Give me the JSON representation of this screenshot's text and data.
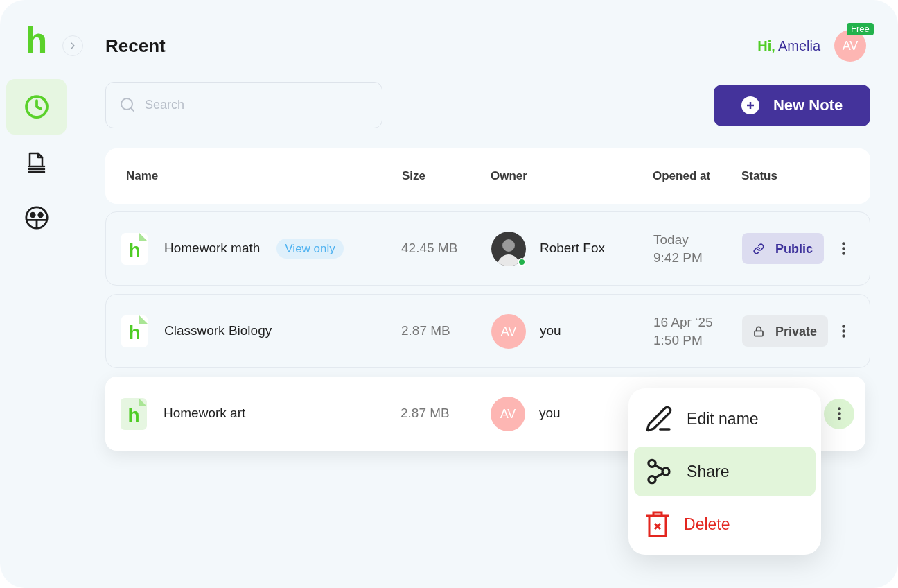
{
  "logo": {
    "text": "h"
  },
  "sidebar": {
    "items": [
      {
        "kind": "recent",
        "selected": true
      },
      {
        "kind": "notes",
        "selected": false
      },
      {
        "kind": "community",
        "selected": false
      }
    ]
  },
  "header": {
    "title": "Recent",
    "greeting_prefix": "Hi,",
    "greeting_name": "Amelia",
    "avatar_initials": "AV",
    "plan_badge": "Free"
  },
  "search": {
    "placeholder": "Search"
  },
  "new_note_button": {
    "label": "New Note"
  },
  "table": {
    "columns": [
      "Name",
      "Size",
      "Owner",
      "Opened at",
      "Status"
    ],
    "rows": [
      {
        "icon_text": "h",
        "name": "Homework math",
        "badge": "View only",
        "size": "42.45 MB",
        "owner": {
          "kind": "photo",
          "name": "Robert Fox",
          "online": true
        },
        "opened": [
          "Today",
          "9:42 PM"
        ],
        "status": {
          "kind": "public",
          "label": "Public"
        },
        "selected": false,
        "menu_open": false
      },
      {
        "icon_text": "h",
        "name": "Classwork Biology",
        "size": "2.87 MB",
        "owner": {
          "kind": "initials",
          "initials": "AV",
          "name": "you",
          "online": false
        },
        "opened": [
          "16 Apr ‘25",
          "1:50 PM"
        ],
        "status": {
          "kind": "private",
          "label": "Private"
        },
        "selected": false,
        "menu_open": false
      },
      {
        "icon_text": "h",
        "name": "Homework art",
        "size": "2.87 MB",
        "owner": {
          "kind": "initials",
          "initials": "AV",
          "name": "you",
          "online": false
        },
        "selected": true,
        "menu_open": true
      }
    ]
  },
  "row_menu": {
    "items": [
      {
        "kind": "edit",
        "label": "Edit name",
        "selected": false
      },
      {
        "kind": "share",
        "label": "Share",
        "selected": true
      },
      {
        "kind": "delete",
        "label": "Delete",
        "selected": false
      }
    ]
  }
}
